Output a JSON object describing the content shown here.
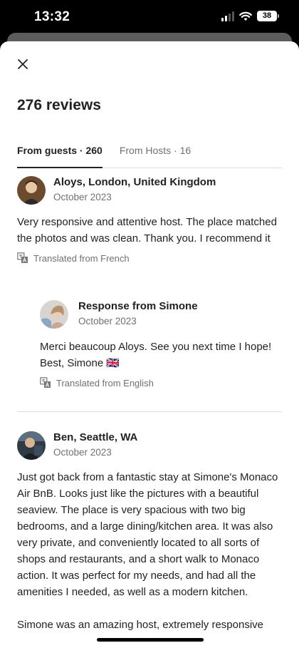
{
  "status": {
    "time": "13:32",
    "battery": "38"
  },
  "header": {
    "title": "276 reviews"
  },
  "tabs": [
    {
      "label": "From guests · 260",
      "active": true
    },
    {
      "label": "From Hosts · 16",
      "active": false
    }
  ],
  "reviews": [
    {
      "name": "Aloys, London, United Kingdom",
      "date": "October 2023",
      "text": "Very responsive and attentive host. The place matched the photos and was clean. Thank you. I recommend it",
      "translated": "Translated from French",
      "response": {
        "title": "Response from Simone",
        "date": "October 2023",
        "text": "Merci beaucoup Aloys. See you next time I hope! Best, Simone 🇬🇧",
        "translated": "Translated from English"
      }
    },
    {
      "name": "Ben, Seattle, WA",
      "date": "October 2023",
      "text": "Just got back from a fantastic stay at Simone's Monaco Air BnB.  Looks just like the pictures with a beautiful seaview.  The place is very spacious with two big bedrooms, and a large dining/kitchen area.  It was also very private, and conveniently located to all sorts of shops and restaurants, and a short walk to Monaco action.  It was perfect for my needs, and had all the amenities I needed, as well as a modern kitchen.",
      "text2": "Simone was an amazing host, extremely responsive"
    }
  ]
}
